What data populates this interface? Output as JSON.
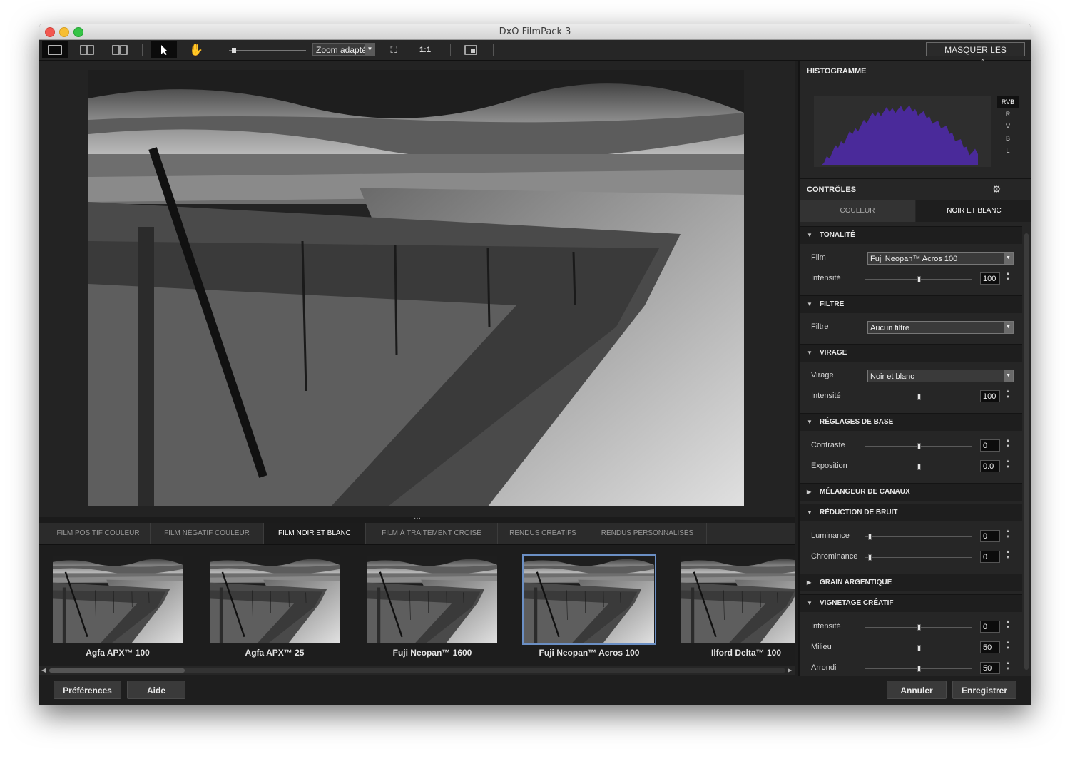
{
  "window": {
    "title": "DxO FilmPack 3"
  },
  "toolbar": {
    "zoom_value": "Zoom adapté",
    "one_to_one": "1:1",
    "hide_controls": "MASQUER LES CONTRÔLES"
  },
  "tabs": [
    "FILM POSITIF COULEUR",
    "FILM NÉGATIF COULEUR",
    "FILM NOIR ET BLANC",
    "FILM À TRAITEMENT CROISÉ",
    "RENDUS CRÉATIFS",
    "RENDUS PERSONNALISÉS"
  ],
  "active_tab": "FILM NOIR ET BLANC",
  "thumbnails": [
    "Agfa APX™ 100",
    "Agfa APX™ 25",
    "Fuji Neopan™ 1600",
    "Fuji Neopan™ Acros 100",
    "Ilford Delta™ 100"
  ],
  "selected_thumbnail": "Fuji Neopan™ Acros 100",
  "footer": {
    "preferences": "Préférences",
    "help": "Aide",
    "cancel": "Annuler",
    "save": "Enregistrer"
  },
  "panel": {
    "histogram_title": "HISTOGRAMME",
    "histogram_channels": [
      "RVB",
      "R",
      "V",
      "B",
      "L"
    ],
    "histogram_color": "#4a2a9a",
    "controls_title": "CONTRÔLES",
    "mode_tabs": [
      "COULEUR",
      "NOIR ET BLANC"
    ],
    "sections": {
      "tonalite": {
        "title": "TONALITÉ",
        "film_label": "Film",
        "film_value": "Fuji Neopan™ Acros 100",
        "intensity_label": "Intensité",
        "intensity_value": "100"
      },
      "filtre": {
        "title": "FILTRE",
        "filter_label": "Filtre",
        "filter_value": "Aucun filtre"
      },
      "virage": {
        "title": "VIRAGE",
        "virage_label": "Virage",
        "virage_value": "Noir et blanc",
        "intensity_label": "Intensité",
        "intensity_value": "100"
      },
      "reglages": {
        "title": "RÉGLAGES DE BASE",
        "contrast_label": "Contraste",
        "contrast_value": "0",
        "exposure_label": "Exposition",
        "exposure_value": "0.0"
      },
      "melangeur": {
        "title": "MÉLANGEUR DE CANAUX"
      },
      "bruit": {
        "title": "RÉDUCTION DE BRUIT",
        "luminance_label": "Luminance",
        "luminance_value": "0",
        "chrominance_label": "Chrominance",
        "chrominance_value": "0"
      },
      "grain": {
        "title": "GRAIN ARGENTIQUE"
      },
      "vignetage": {
        "title": "VIGNETAGE CRÉATIF",
        "intensity_label": "Intensité",
        "intensity_value": "0",
        "middle_label": "Milieu",
        "middle_value": "50",
        "round_label": "Arrondi",
        "round_value": "50"
      }
    }
  }
}
